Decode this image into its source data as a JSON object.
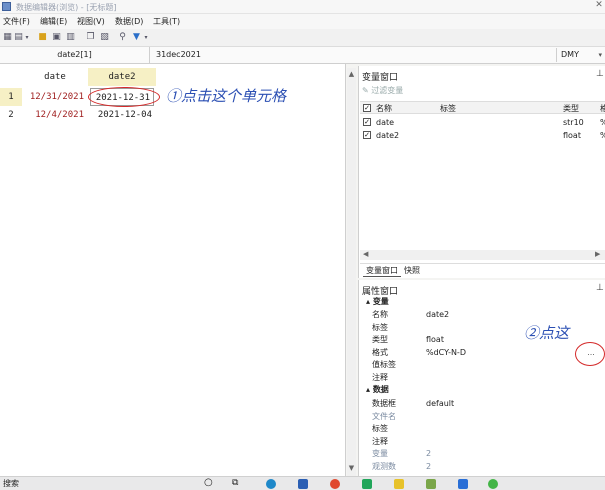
{
  "window": {
    "title": "数据编辑器(浏览) - [无标题]"
  },
  "menu": [
    {
      "label": "文件(F)"
    },
    {
      "label": "编辑(E)"
    },
    {
      "label": "视图(V)"
    },
    {
      "label": "数据(D)"
    },
    {
      "label": "工具(T)"
    }
  ],
  "toolbar": {
    "icons": [
      "grid-icon",
      "open-icon",
      "folder-icon",
      "save-icon",
      "print-icon",
      "copy-icon",
      "paste-icon",
      "find-icon",
      "filter-icon"
    ]
  },
  "cellbar": {
    "cell_name": "date2[1]",
    "cell_value": "31dec2021",
    "format": "DMY"
  },
  "grid": {
    "columns": [
      {
        "name": "date"
      },
      {
        "name": "date2"
      }
    ],
    "rows": [
      {
        "num": "1",
        "date": "12/31/2021",
        "date2": "2021-12-31"
      },
      {
        "num": "2",
        "date": "12/4/2021",
        "date2": "2021-12-04"
      }
    ],
    "annotation1": "①点击这个单元格"
  },
  "variables_panel": {
    "title": "变量窗口",
    "filter_placeholder": "过滤变量",
    "headers": {
      "name": "名称",
      "label": "标签",
      "type": "类型",
      "format": "格"
    },
    "rows": [
      {
        "name": "date",
        "label": "",
        "type": "str10",
        "format": "%"
      },
      {
        "name": "date2",
        "label": "",
        "type": "float",
        "format": "%"
      }
    ],
    "tabs": [
      "变量窗口",
      "快照"
    ]
  },
  "properties_panel": {
    "title": "属性窗口",
    "rows": [
      {
        "key": "变量",
        "value": "",
        "section": true
      },
      {
        "key": "名称",
        "value": "date2"
      },
      {
        "key": "标签",
        "value": ""
      },
      {
        "key": "类型",
        "value": "float"
      },
      {
        "key": "格式",
        "value": "%dCY-N-D"
      },
      {
        "key": "值标签",
        "value": ""
      },
      {
        "key": "注释",
        "value": ""
      },
      {
        "key": "数据",
        "value": "",
        "section": true
      },
      {
        "key": "数据框",
        "value": "default"
      },
      {
        "key": "文件名",
        "value": ""
      },
      {
        "key": "标签",
        "value": ""
      },
      {
        "key": "注释",
        "value": ""
      },
      {
        "key": "变量",
        "value": "2",
        "dim": true
      },
      {
        "key": "观测数",
        "value": "2",
        "dim": true
      }
    ],
    "ellipsis": "...",
    "annotation2": "②点这"
  },
  "taskbar": {
    "search_label": "搜索"
  },
  "colors": {
    "selection": "#f6f0c5",
    "annotation_ink": "#2b4fb3",
    "annotation_circle": "#d42a2a",
    "date_red": "#a02020"
  }
}
